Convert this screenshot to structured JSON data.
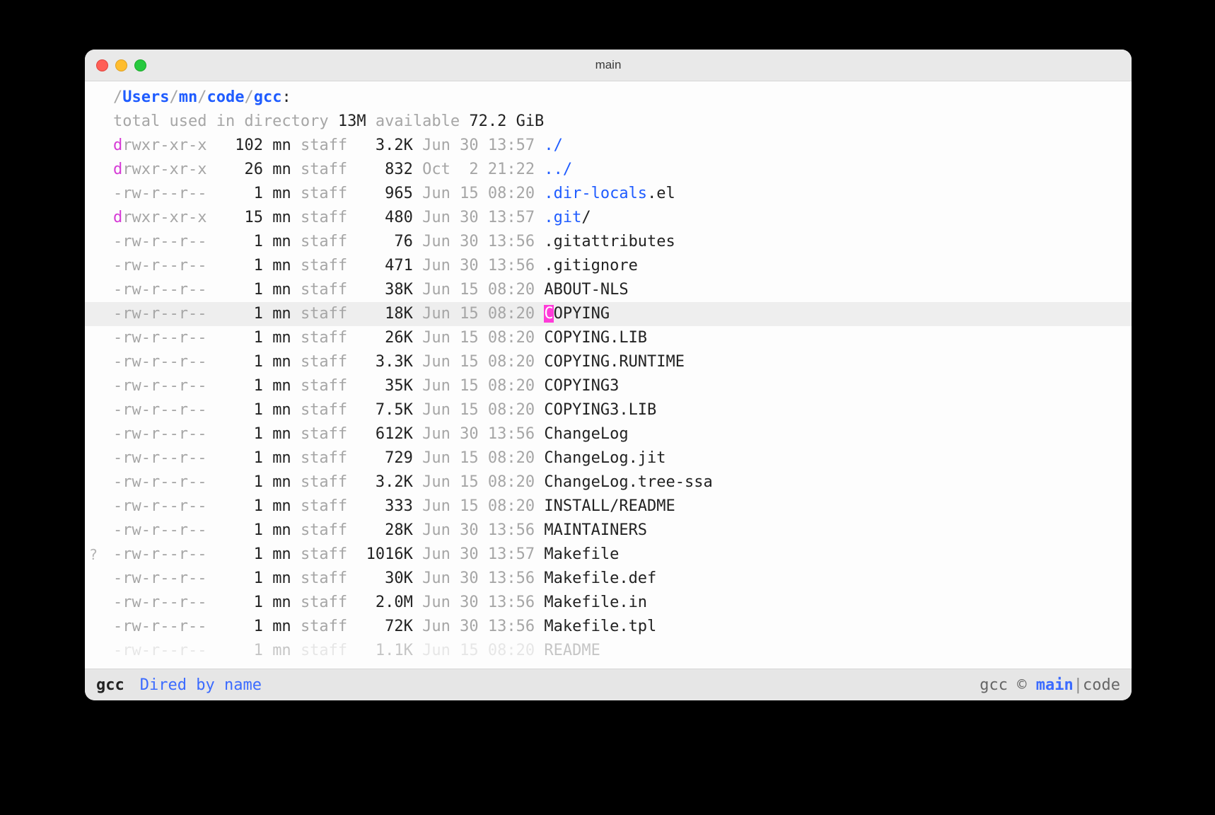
{
  "window": {
    "title": "main"
  },
  "path": {
    "sep": "/",
    "parts": [
      "Users",
      "mn",
      "code",
      "gcc"
    ],
    "tail": ":"
  },
  "header": {
    "pre": "total used in directory ",
    "used": "13M",
    "mid": " available ",
    "avail": "72.2 GiB"
  },
  "cols": {
    "links_w": 5,
    "size_w": 6
  },
  "entries": [
    {
      "type": "dir",
      "perms": "drwxr-xr-x",
      "links": "102",
      "own": "mn",
      "grp": "staff",
      "size": "3.2K",
      "date": "Jun 30 13:57",
      "name": "./"
    },
    {
      "type": "dir",
      "perms": "drwxr-xr-x",
      "links": "26",
      "own": "mn",
      "grp": "staff",
      "size": "832",
      "date": "Oct  2 21:22",
      "name": "../"
    },
    {
      "type": "file",
      "perms": "-rw-r--r--",
      "links": "1",
      "own": "mn",
      "grp": "staff",
      "size": "965",
      "date": "Jun 15 08:20",
      "name": ".dir-locals",
      "name_style": "blue-n",
      "suffix": ".el"
    },
    {
      "type": "dir",
      "perms": "drwxr-xr-x",
      "links": "15",
      "own": "mn",
      "grp": "staff",
      "size": "480",
      "date": "Jun 30 13:57",
      "name": ".git",
      "name_style": "blue-n",
      "suffix": "/"
    },
    {
      "type": "file",
      "perms": "-rw-r--r--",
      "links": "1",
      "own": "mn",
      "grp": "staff",
      "size": "76",
      "date": "Jun 30 13:56",
      "name": ".gitattributes"
    },
    {
      "type": "file",
      "perms": "-rw-r--r--",
      "links": "1",
      "own": "mn",
      "grp": "staff",
      "size": "471",
      "date": "Jun 30 13:56",
      "name": ".gitignore"
    },
    {
      "type": "file",
      "perms": "-rw-r--r--",
      "links": "1",
      "own": "mn",
      "grp": "staff",
      "size": "38K",
      "date": "Jun 15 08:20",
      "name": "ABOUT-NLS"
    },
    {
      "type": "file",
      "perms": "-rw-r--r--",
      "links": "1",
      "own": "mn",
      "grp": "staff",
      "size": "18K",
      "date": "Jun 15 08:20",
      "name": "COPYING",
      "cursor": true,
      "hl": true
    },
    {
      "type": "file",
      "perms": "-rw-r--r--",
      "links": "1",
      "own": "mn",
      "grp": "staff",
      "size": "26K",
      "date": "Jun 15 08:20",
      "name": "COPYING.LIB"
    },
    {
      "type": "file",
      "perms": "-rw-r--r--",
      "links": "1",
      "own": "mn",
      "grp": "staff",
      "size": "3.3K",
      "date": "Jun 15 08:20",
      "name": "COPYING.RUNTIME"
    },
    {
      "type": "file",
      "perms": "-rw-r--r--",
      "links": "1",
      "own": "mn",
      "grp": "staff",
      "size": "35K",
      "date": "Jun 15 08:20",
      "name": "COPYING3"
    },
    {
      "type": "file",
      "perms": "-rw-r--r--",
      "links": "1",
      "own": "mn",
      "grp": "staff",
      "size": "7.5K",
      "date": "Jun 15 08:20",
      "name": "COPYING3.LIB"
    },
    {
      "type": "file",
      "perms": "-rw-r--r--",
      "links": "1",
      "own": "mn",
      "grp": "staff",
      "size": "612K",
      "date": "Jun 30 13:56",
      "name": "ChangeLog"
    },
    {
      "type": "file",
      "perms": "-rw-r--r--",
      "links": "1",
      "own": "mn",
      "grp": "staff",
      "size": "729",
      "date": "Jun 15 08:20",
      "name": "ChangeLog.jit"
    },
    {
      "type": "file",
      "perms": "-rw-r--r--",
      "links": "1",
      "own": "mn",
      "grp": "staff",
      "size": "3.2K",
      "date": "Jun 15 08:20",
      "name": "ChangeLog.tree-ssa"
    },
    {
      "type": "file",
      "perms": "-rw-r--r--",
      "links": "1",
      "own": "mn",
      "grp": "staff",
      "size": "333",
      "date": "Jun 15 08:20",
      "name": "INSTALL/README"
    },
    {
      "type": "file",
      "perms": "-rw-r--r--",
      "links": "1",
      "own": "mn",
      "grp": "staff",
      "size": "28K",
      "date": "Jun 30 13:56",
      "name": "MAINTAINERS"
    },
    {
      "type": "file",
      "perms": "-rw-r--r--",
      "links": "1",
      "own": "mn",
      "grp": "staff",
      "size": "1016K",
      "date": "Jun 30 13:57",
      "name": "Makefile",
      "fringe": "?"
    },
    {
      "type": "file",
      "perms": "-rw-r--r--",
      "links": "1",
      "own": "mn",
      "grp": "staff",
      "size": "30K",
      "date": "Jun 30 13:56",
      "name": "Makefile.def"
    },
    {
      "type": "file",
      "perms": "-rw-r--r--",
      "links": "1",
      "own": "mn",
      "grp": "staff",
      "size": "2.0M",
      "date": "Jun 30 13:56",
      "name": "Makefile.in"
    },
    {
      "type": "file",
      "perms": "-rw-r--r--",
      "links": "1",
      "own": "mn",
      "grp": "staff",
      "size": "72K",
      "date": "Jun 30 13:56",
      "name": "Makefile.tpl"
    },
    {
      "type": "file",
      "perms": "-rw-r--r--",
      "links": "1",
      "own": "mn",
      "grp": "staff",
      "size": "1.1K",
      "date": "Jun 15 08:20",
      "name": "README",
      "partial": true
    }
  ],
  "modeline": {
    "buffer": "gcc",
    "mode": "Dired by name",
    "vc_project": "gcc",
    "vc_sym": "©",
    "vc_branch": "main",
    "vc_sep": "|",
    "vc_extra": "code"
  }
}
